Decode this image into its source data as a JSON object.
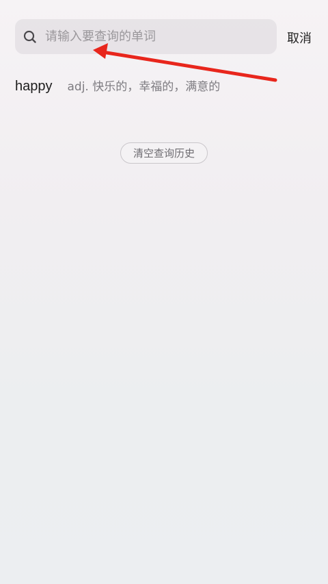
{
  "search": {
    "placeholder": "请输入要查询的单词",
    "value": "",
    "icon": "search-icon"
  },
  "cancel_label": "取消",
  "history": {
    "items": [
      {
        "word": "happy",
        "definition": "adj. 快乐的，幸福的，满意的"
      }
    ],
    "clear_label": "清空查询历史"
  },
  "annotation": {
    "color": "#e8261c",
    "icon": "arrow-annotation"
  }
}
